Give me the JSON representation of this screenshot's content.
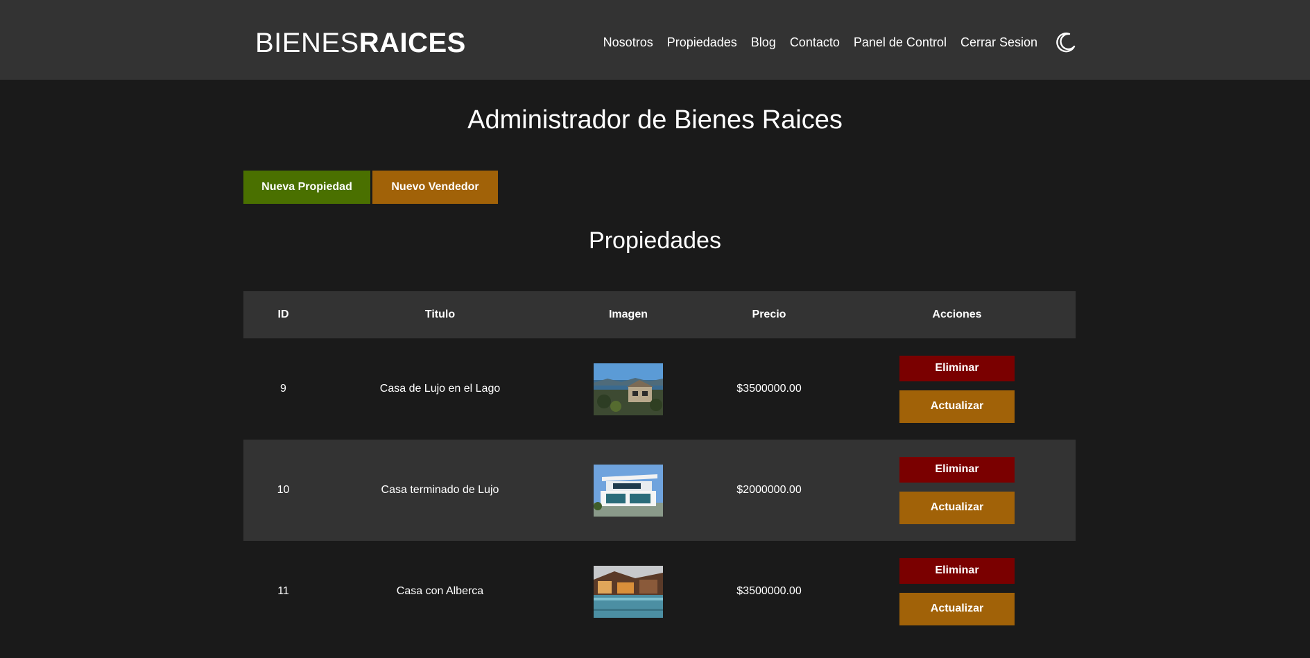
{
  "header": {
    "logo_light": "BIENES",
    "logo_bold": "RAICES",
    "nav": [
      "Nosotros",
      "Propiedades",
      "Blog",
      "Contacto",
      "Panel de Control",
      "Cerrar Sesion"
    ],
    "theme_icon": "moon-icon"
  },
  "main": {
    "title": "Administrador de Bienes Raices",
    "new_property_label": "Nueva Propiedad",
    "new_seller_label": "Nuevo Vendedor",
    "section_title": "Propiedades"
  },
  "table": {
    "headers": [
      "ID",
      "Titulo",
      "Imagen",
      "Precio",
      "Acciones"
    ],
    "rows": [
      {
        "id": "9",
        "title": "Casa de Lujo en el Lago",
        "price": "$3500000.00",
        "delete_label": "Eliminar",
        "update_label": "Actualizar"
      },
      {
        "id": "10",
        "title": "Casa terminado de Lujo",
        "price": "$2000000.00",
        "delete_label": "Eliminar",
        "update_label": "Actualizar"
      },
      {
        "id": "11",
        "title": "Casa con Alberca",
        "price": "$3500000.00",
        "delete_label": "Eliminar",
        "update_label": "Actualizar"
      }
    ]
  },
  "colors": {
    "header_bg": "#333333",
    "page_bg": "#1a1a1a",
    "green": "#4a7000",
    "orange": "#a16208",
    "red": "#7a0000"
  }
}
